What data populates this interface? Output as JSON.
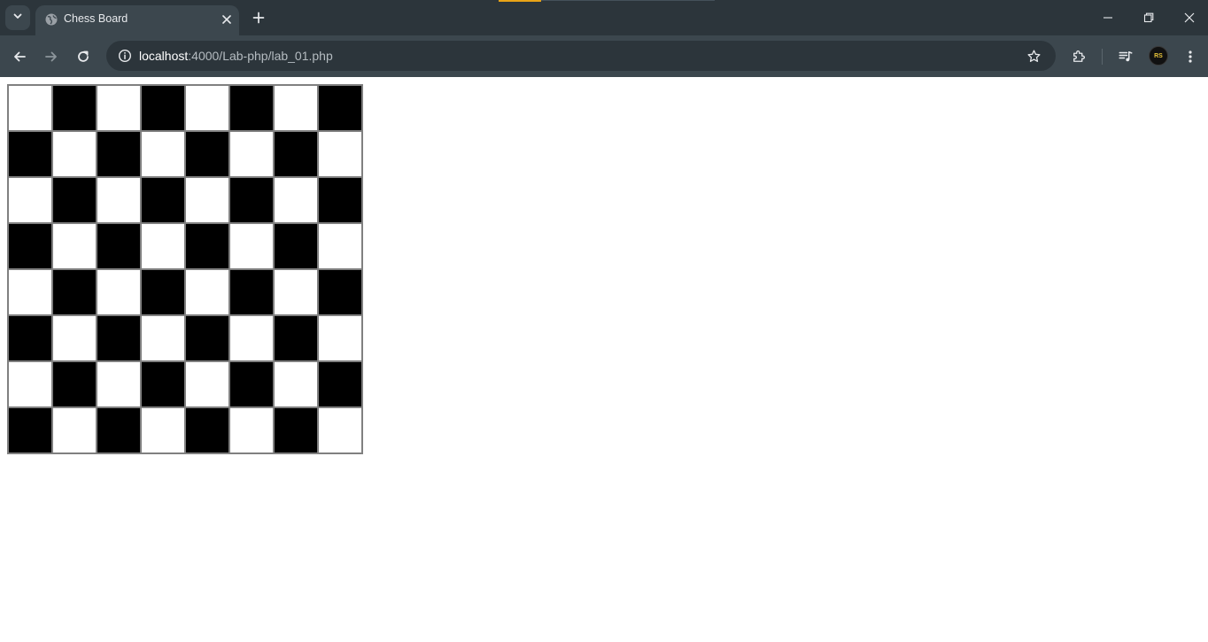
{
  "browser": {
    "tab": {
      "title": "Chess Board",
      "favicon": "globe-icon"
    },
    "address": {
      "host": "localhost",
      "path": ":4000/Lab-php/lab_01.php"
    },
    "profile_initials": "RS",
    "colors": {
      "frame": "#2c353b",
      "toolbar": "#3c474e",
      "loading_accent": "#e8a317"
    }
  },
  "page": {
    "board": {
      "rows": 8,
      "cols": 8,
      "first_square": "white",
      "light_color": "#ffffff",
      "dark_color": "#000000",
      "border_color": "#808080"
    }
  }
}
